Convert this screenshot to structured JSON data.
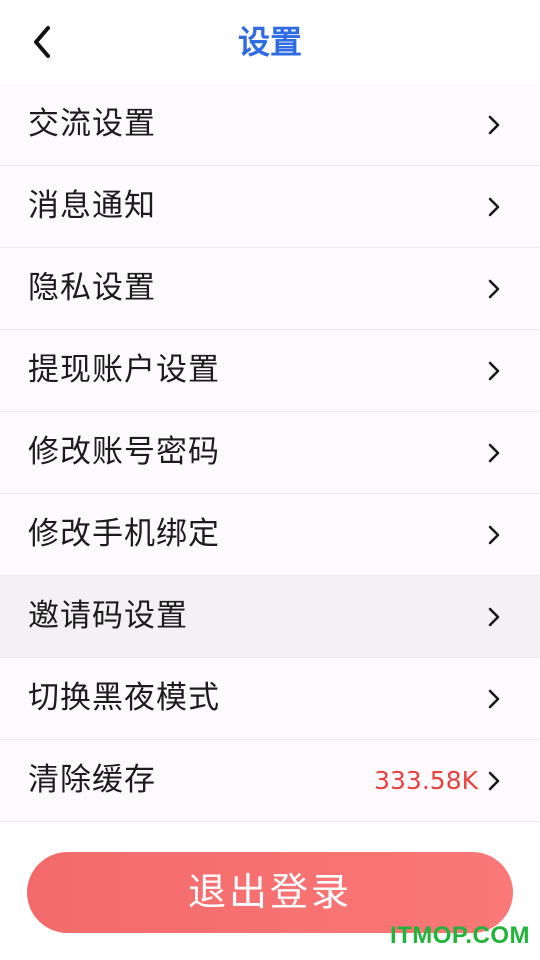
{
  "colors": {
    "accent": "#2f6be3",
    "value_red": "#e8423f",
    "logout_start": "#f46a6b",
    "logout_end": "#fa7878",
    "watermark": "#22b43a"
  },
  "header": {
    "title": "设置",
    "back_icon": "chevron-left-icon"
  },
  "menu": {
    "items": [
      {
        "label": "交流设置",
        "value": ""
      },
      {
        "label": "消息通知",
        "value": ""
      },
      {
        "label": "隐私设置",
        "value": ""
      },
      {
        "label": "提现账户设置",
        "value": ""
      },
      {
        "label": "修改账号密码",
        "value": ""
      },
      {
        "label": "修改手机绑定",
        "value": ""
      },
      {
        "label": "邀请码设置",
        "value": ""
      },
      {
        "label": "切换黑夜模式",
        "value": ""
      },
      {
        "label": "清除缓存",
        "value": "333.58K"
      }
    ]
  },
  "logout_label": "退出登录",
  "watermark": "ITMOP.COM"
}
